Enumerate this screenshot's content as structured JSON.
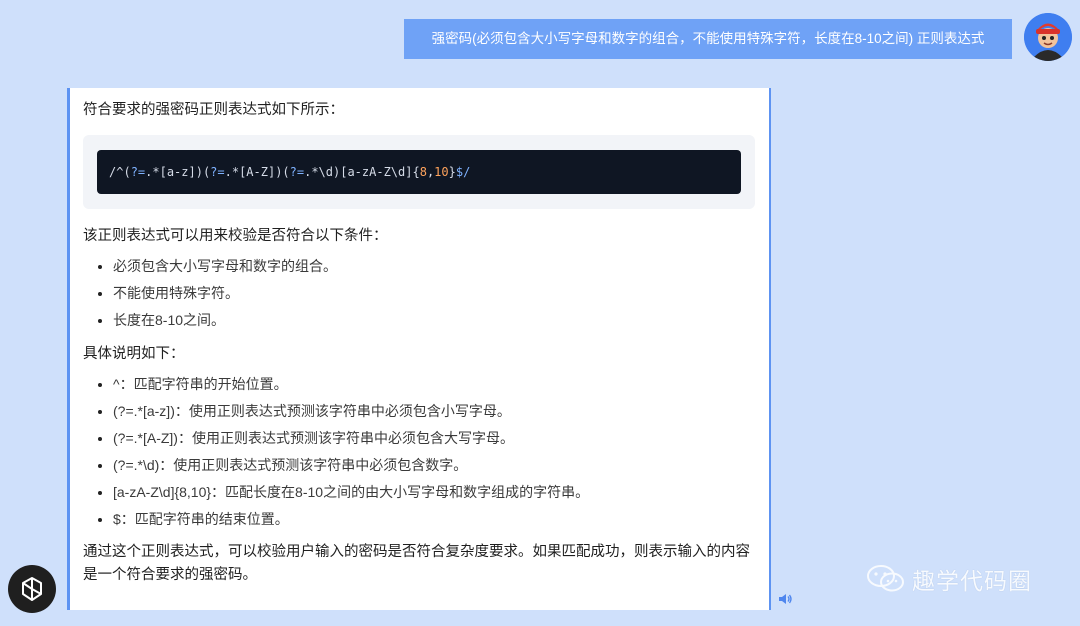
{
  "user_message": {
    "text": "强密码(必须包含大小写字母和数字的组合，不能使用特殊字符，长度在8-10之间) 正则表达式"
  },
  "assistant": {
    "intro": "符合要求的强密码正则表达式如下所示：",
    "code": {
      "line": "/^(?=.*[a-z])(?=.*[A-Z])(?=.*\\d)[a-zA-Z\\d]{8,10}$/"
    },
    "conditions_title": "该正则表达式可以用来校验是否符合以下条件：",
    "conditions": [
      "必须包含大小写字母和数字的组合。",
      "不能使用特殊字符。",
      "长度在8-10之间。"
    ],
    "details_title": "具体说明如下：",
    "details": [
      "^：匹配字符串的开始位置。",
      "(?=.*[a-z])：使用正则表达式预测该字符串中必须包含小写字母。",
      "(?=.*[A-Z])：使用正则表达式预测该字符串中必须包含大写字母。",
      "(?=.*\\d)：使用正则表达式预测该字符串中必须包含数字。",
      "[a-zA-Z\\d]{8,10}：匹配长度在8-10之间的由大小写字母和数字组成的字符串。",
      "$：匹配字符串的结束位置。"
    ],
    "conclusion": "通过这个正则表达式，可以校验用户输入的密码是否符合复杂度要求。如果匹配成功，则表示输入的内容是一个符合要求的强密码。"
  },
  "watermark": {
    "text": "趣学代码圈"
  },
  "colors": {
    "page_bg": "#cfe0fb",
    "user_bubble": "#6fa2f6",
    "card_border": "#5d93f2",
    "code_bg": "#0f1623"
  },
  "icons": [
    "user-avatar-icon",
    "openai-logo-icon",
    "speaker-icon",
    "wechat-icon"
  ]
}
